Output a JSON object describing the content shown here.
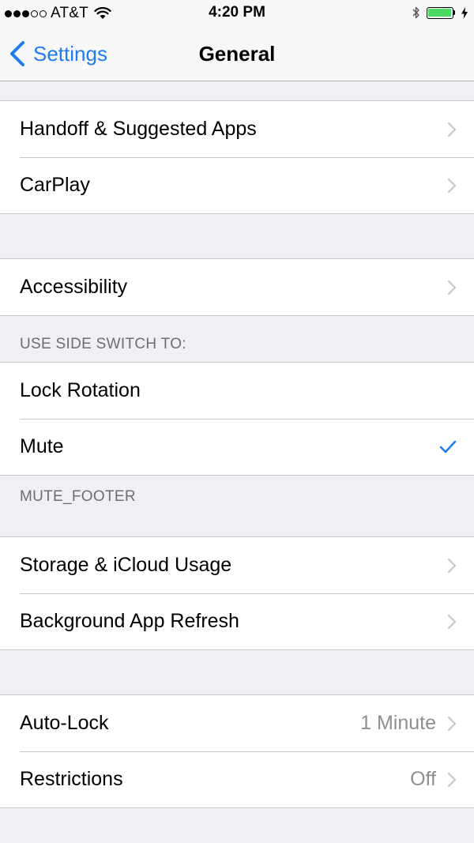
{
  "status_bar": {
    "signal_filled": 3,
    "signal_total": 5,
    "carrier": "AT&T",
    "time": "4:20 PM",
    "battery_level": 1.0,
    "battery_color": "#4cd964"
  },
  "nav": {
    "back_label": "Settings",
    "title": "General"
  },
  "groups": {
    "handoff": {
      "items": [
        {
          "label": "Handoff & Suggested Apps"
        },
        {
          "label": "CarPlay"
        }
      ]
    },
    "accessibility": {
      "items": [
        {
          "label": "Accessibility"
        }
      ]
    },
    "side_switch": {
      "header": "USE SIDE SWITCH TO:",
      "items": [
        {
          "label": "Lock Rotation",
          "checked": false
        },
        {
          "label": "Mute",
          "checked": true
        }
      ],
      "footer": "MUTE_FOOTER"
    },
    "storage": {
      "items": [
        {
          "label": "Storage & iCloud Usage"
        },
        {
          "label": "Background App Refresh"
        }
      ]
    },
    "lock": {
      "items": [
        {
          "label": "Auto-Lock",
          "value": "1 Minute"
        },
        {
          "label": "Restrictions",
          "value": "Off"
        }
      ]
    }
  },
  "colors": {
    "tint": "#1f7cf5",
    "background": "#efeff4",
    "separator": "#c8c7cc",
    "secondary_text": "#8e8e93",
    "chevron": "#c7c7cc"
  },
  "icons": [
    "signal-dots",
    "wifi-icon",
    "bluetooth-icon",
    "battery-icon",
    "charging-bolt-icon",
    "back-chevron-icon",
    "chevron-right-icon",
    "checkmark-icon"
  ]
}
